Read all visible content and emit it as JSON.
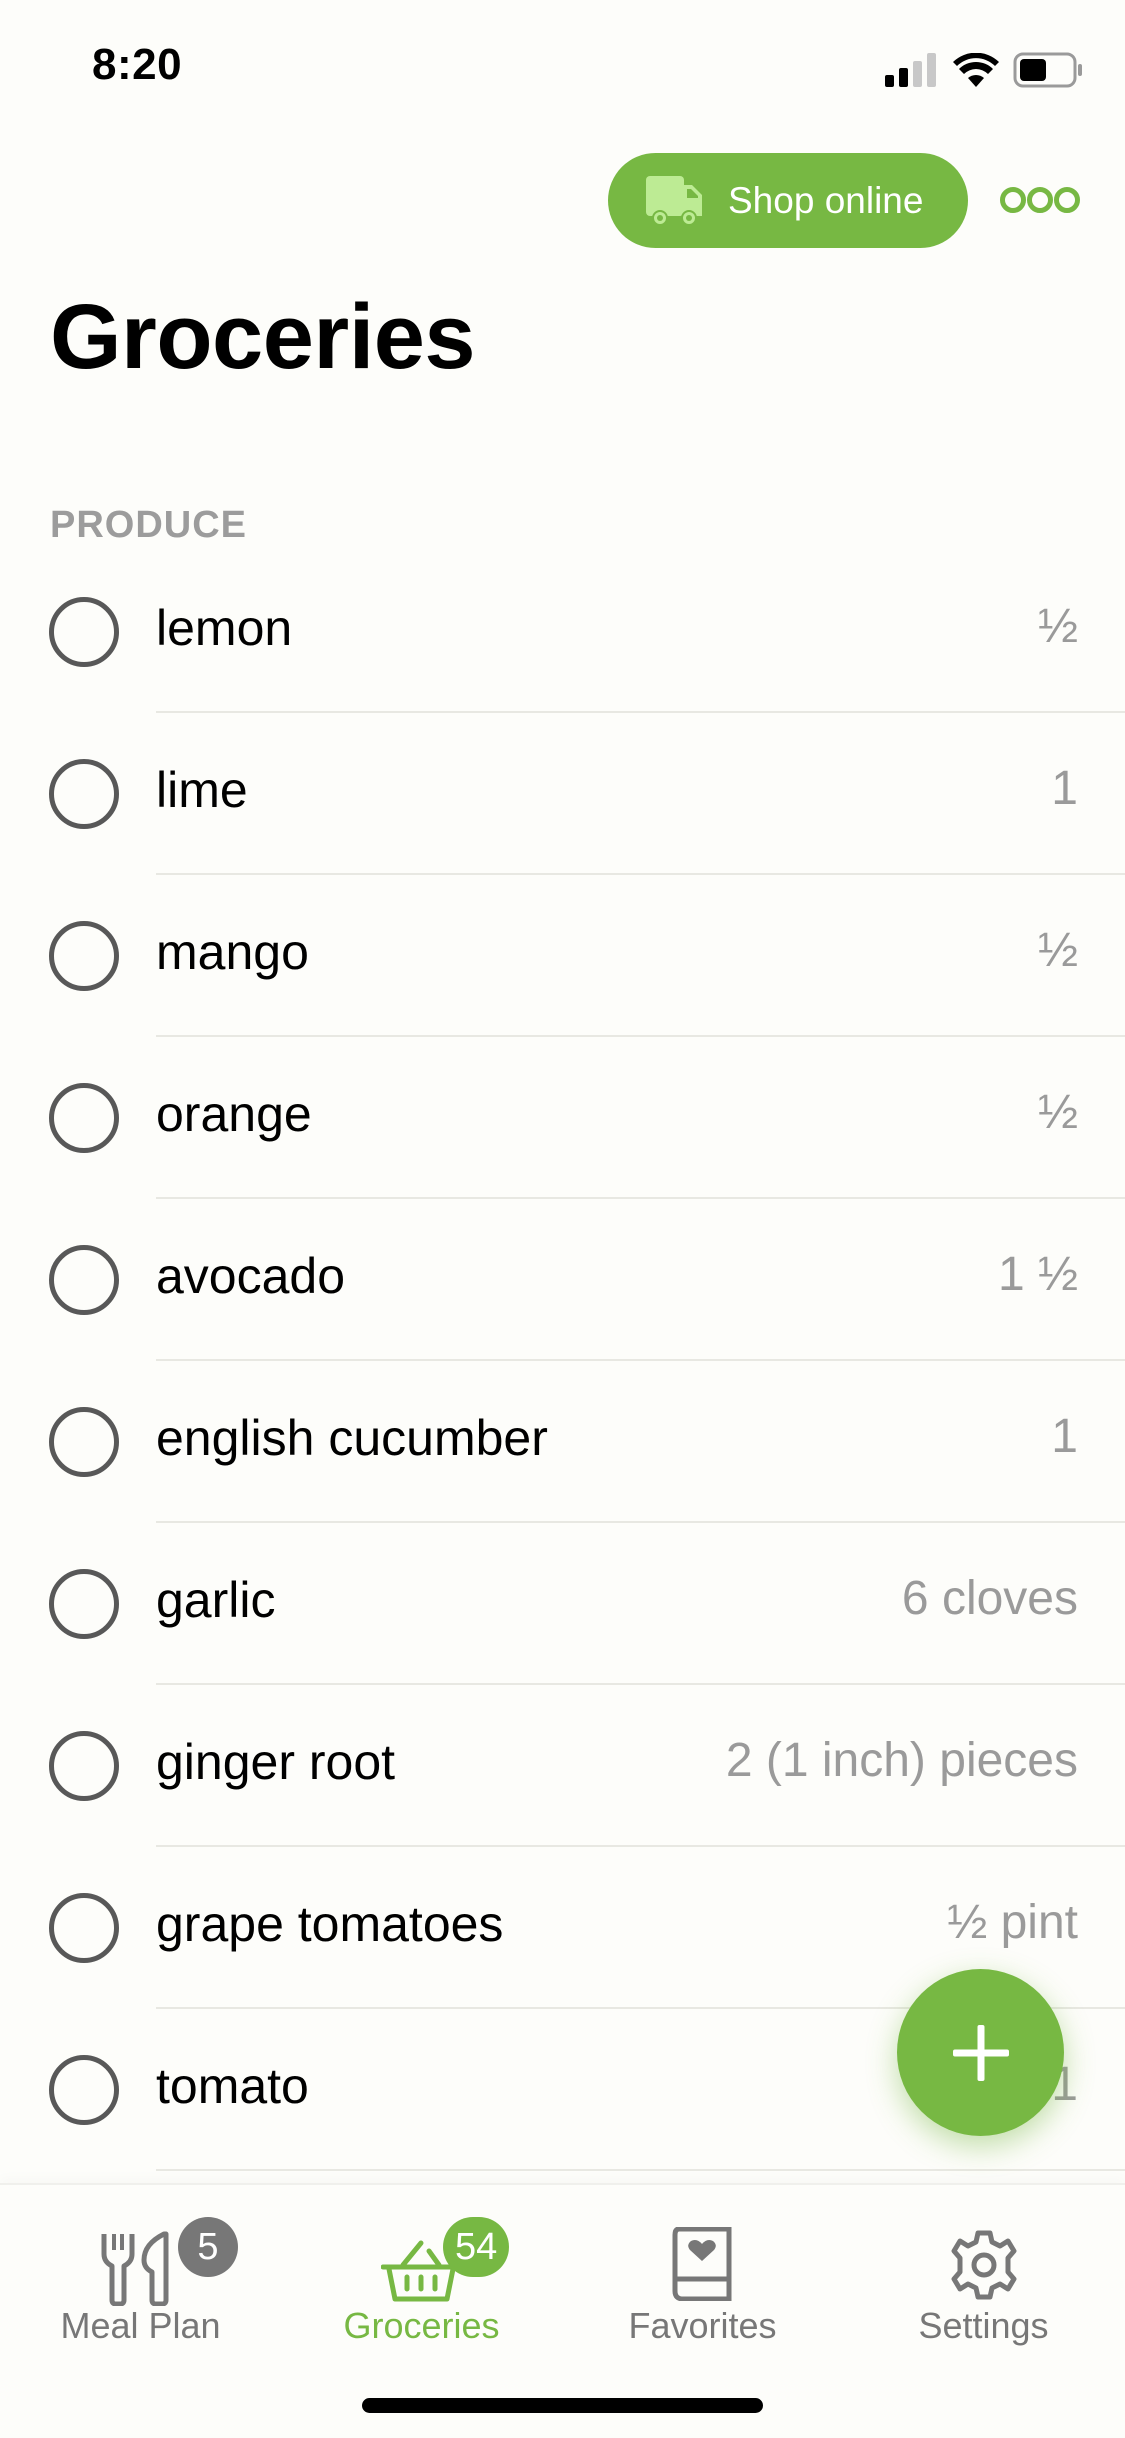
{
  "status_bar": {
    "time": "8:20",
    "signal_icon": "cellular-signal-icon",
    "wifi_icon": "wifi-icon",
    "battery_icon": "battery-icon"
  },
  "header": {
    "shop_online_label": "Shop online",
    "shop_icon": "delivery-truck-icon",
    "more_icon": "more-options-icon",
    "title": "Groceries"
  },
  "colors": {
    "accent": "#77b843",
    "truck_fill": "#bdeb94",
    "secondary_text": "#9a9a9a",
    "tab_inactive": "#777777"
  },
  "section": {
    "label": "PRODUCE",
    "items": [
      {
        "name": "lemon",
        "qty": "½",
        "checked": false
      },
      {
        "name": "lime",
        "qty": "1",
        "checked": false
      },
      {
        "name": "mango",
        "qty": "½",
        "checked": false
      },
      {
        "name": "orange",
        "qty": "½",
        "checked": false
      },
      {
        "name": "avocado",
        "qty": "1 ½",
        "checked": false
      },
      {
        "name": "english cucumber",
        "qty": "1",
        "checked": false
      },
      {
        "name": "garlic",
        "qty": "6 cloves",
        "checked": false
      },
      {
        "name": "ginger root",
        "qty": "2 (1 inch) pieces",
        "checked": false
      },
      {
        "name": "grape tomatoes",
        "qty": "½ pint",
        "checked": false
      },
      {
        "name": "tomato",
        "qty": "1",
        "checked": false
      }
    ]
  },
  "fab": {
    "icon": "plus-icon"
  },
  "tabbar": {
    "tabs": [
      {
        "label": "Meal Plan",
        "icon": "fork-knife-icon",
        "badge": "5",
        "active": false
      },
      {
        "label": "Groceries",
        "icon": "basket-icon",
        "badge": "54",
        "active": true
      },
      {
        "label": "Favorites",
        "icon": "heart-book-icon",
        "badge": null,
        "active": false
      },
      {
        "label": "Settings",
        "icon": "gear-icon",
        "badge": null,
        "active": false
      }
    ]
  }
}
